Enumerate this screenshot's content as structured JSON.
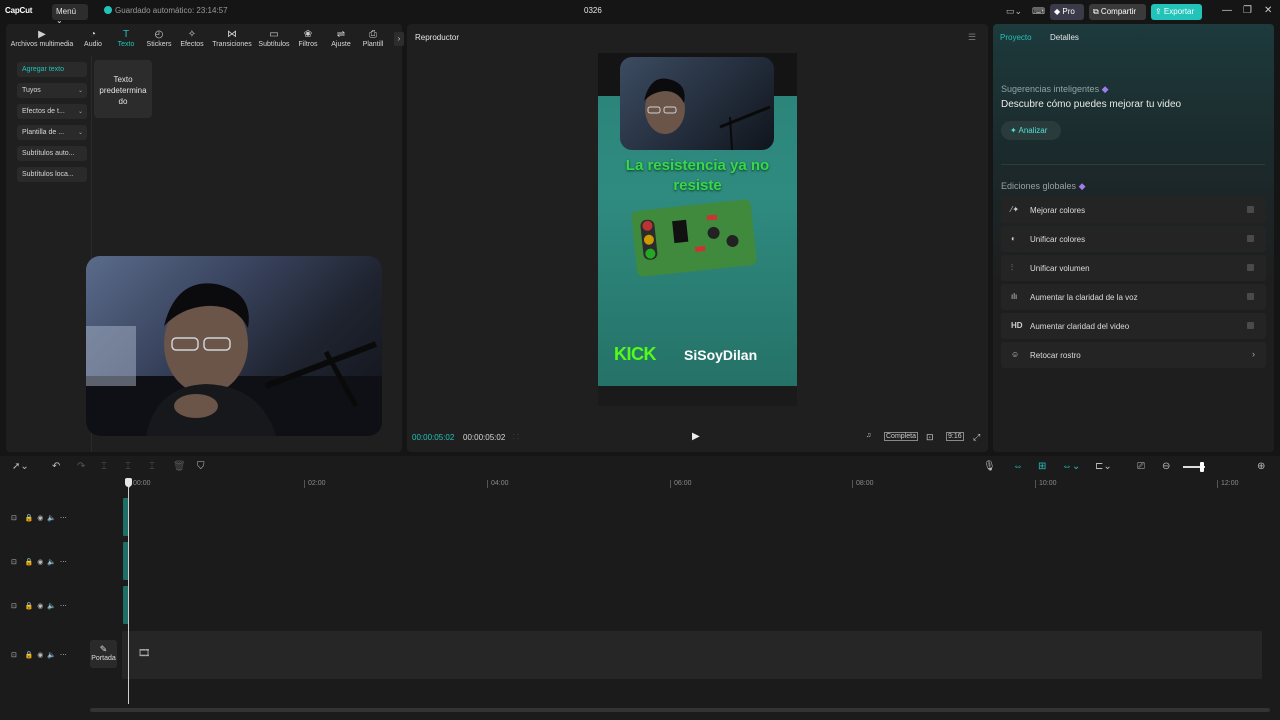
{
  "titlebar": {
    "logo": "CapCut",
    "menu": "Menú ⌄",
    "autosave": "Guardado automático: 23:14:57",
    "project_name": "0326",
    "pro": "◆ Pro",
    "share": "⧉ Compartir",
    "export": "⇪ Exportar"
  },
  "tool_tabs": [
    {
      "label": "Archivos multimedia",
      "icon": "media-icon"
    },
    {
      "label": "Audio",
      "icon": "audio-icon"
    },
    {
      "label": "Texto",
      "icon": "text-icon"
    },
    {
      "label": "Stickers",
      "icon": "sticker-icon"
    },
    {
      "label": "Efectos",
      "icon": "effects-icon"
    },
    {
      "label": "Transiciones",
      "icon": "transitions-icon"
    },
    {
      "label": "Subtítulos",
      "icon": "subtitles-icon"
    },
    {
      "label": "Filtros",
      "icon": "filters-icon"
    },
    {
      "label": "Ajuste",
      "icon": "adjust-icon"
    },
    {
      "label": "Plantill",
      "icon": "template-icon"
    }
  ],
  "text_nav": [
    {
      "label": "Agregar texto"
    },
    {
      "label": "Tuyos"
    },
    {
      "label": "Efectos de t..."
    },
    {
      "label": "Plantilla de ..."
    },
    {
      "label": "Subtítulos auto..."
    },
    {
      "label": "Subtítulos loca..."
    }
  ],
  "preset": {
    "label": "Texto predetermina do"
  },
  "player": {
    "title": "Reproductor",
    "caption_line1": "La resistencia ya no",
    "caption_line2": "resiste",
    "kick": "KICK",
    "username": "SiSoyDilan",
    "current_time": "00:00:05:02",
    "total_time": "00:00:05:02",
    "full_label": "Completa",
    "ratio_label": "9:16"
  },
  "right_panel": {
    "tab_project": "Proyecto",
    "tab_details": "Detalles",
    "suggestions_title": "Sugerencias inteligentes",
    "suggestions_sub": "Descubre cómo puedes mejorar tu video",
    "analyze": "Analizar",
    "global_title": "Ediciones globales",
    "edits": [
      {
        "label": "Mejorar colores",
        "icon": "wand-icon",
        "kind": "toggle"
      },
      {
        "label": "Unificar colores",
        "icon": "palette-icon",
        "kind": "toggle"
      },
      {
        "label": "Unificar volumen",
        "icon": "sliders-icon",
        "kind": "toggle"
      },
      {
        "label": "Aumentar la claridad de la voz",
        "icon": "waveform-icon",
        "kind": "toggle"
      },
      {
        "label": "Aumentar claridad del video",
        "icon": "hd-icon",
        "kind": "toggle"
      },
      {
        "label": "Retocar rostro",
        "icon": "face-icon",
        "kind": "chevron"
      }
    ]
  },
  "timeline": {
    "ruler": [
      "00:00",
      "02:00",
      "04:00",
      "06:00",
      "08:00",
      "10:00",
      "12:00"
    ],
    "cover_label": "Portada"
  },
  "colors": {
    "accent": "#22c3b9",
    "kick_green": "#53fc18",
    "caption_green": "#39d84a"
  }
}
